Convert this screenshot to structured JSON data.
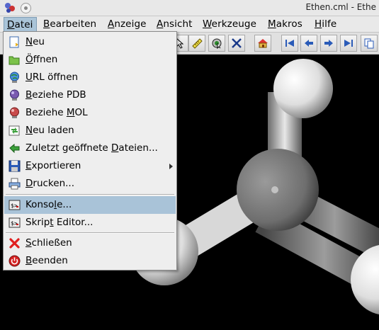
{
  "window": {
    "title": "Ethen.cml - Ethe"
  },
  "menubar": {
    "items": [
      {
        "label": "Datei",
        "mnemonic": "D",
        "rest": "atei"
      },
      {
        "label": "Bearbeiten",
        "mnemonic": "B",
        "rest": "earbeiten"
      },
      {
        "label": "Anzeige",
        "mnemonic": "A",
        "rest": "nzeige"
      },
      {
        "label": "Ansicht",
        "mnemonic": "A",
        "rest": "nsicht"
      },
      {
        "label": "Werkzeuge",
        "mnemonic": "W",
        "rest": "erkzeuge"
      },
      {
        "label": "Makros",
        "mnemonic": "M",
        "rest": "akros"
      },
      {
        "label": "Hilfe",
        "mnemonic": "H",
        "rest": "ilfe"
      }
    ]
  },
  "file_menu": {
    "items": [
      {
        "label": "Neu",
        "pre": "",
        "u": "N",
        "post": "eu",
        "icon": "new-file-icon"
      },
      {
        "label": "Öffnen",
        "pre": "",
        "u": "Ö",
        "post": "ffnen",
        "icon": "folder-open-icon"
      },
      {
        "label": "URL öffnen",
        "pre": "",
        "u": "U",
        "post": "RL öffnen",
        "icon": "globe-icon"
      },
      {
        "label": "Beziehe PDB",
        "pre": "",
        "u": "B",
        "post": "eziehe PDB",
        "icon": "pdb-molecule-icon"
      },
      {
        "label": "Beziehe MOL",
        "pre": "Beziehe ",
        "u": "M",
        "post": "OL",
        "icon": "mol-molecule-icon"
      },
      {
        "label": "Neu laden",
        "pre": "",
        "u": "N",
        "post": "eu laden",
        "icon": "reload-icon"
      },
      {
        "label": "Zuletzt geöffnete Dateien...",
        "pre": "Zuletzt geöffnete ",
        "u": "D",
        "post": "ateien...",
        "icon": "recent-files-icon"
      },
      {
        "label": "Exportieren",
        "pre": "",
        "u": "E",
        "post": "xportieren",
        "icon": "export-icon"
      },
      {
        "label": "Drucken...",
        "pre": "",
        "u": "D",
        "post": "rucken...",
        "icon": "printer-icon"
      },
      {
        "label": "Konsole...",
        "pre": "Konso",
        "u": "l",
        "post": "e...",
        "icon": "console-icon"
      },
      {
        "label": "Skript Editor...",
        "pre": "Skrip",
        "u": "t",
        "post": " Editor...",
        "icon": "script-editor-icon"
      },
      {
        "label": "Schließen",
        "pre": "",
        "u": "S",
        "post": "chließen",
        "icon": "close-icon"
      },
      {
        "label": "Beenden",
        "pre": "",
        "u": "B",
        "post": "eenden",
        "icon": "power-icon"
      }
    ]
  }
}
